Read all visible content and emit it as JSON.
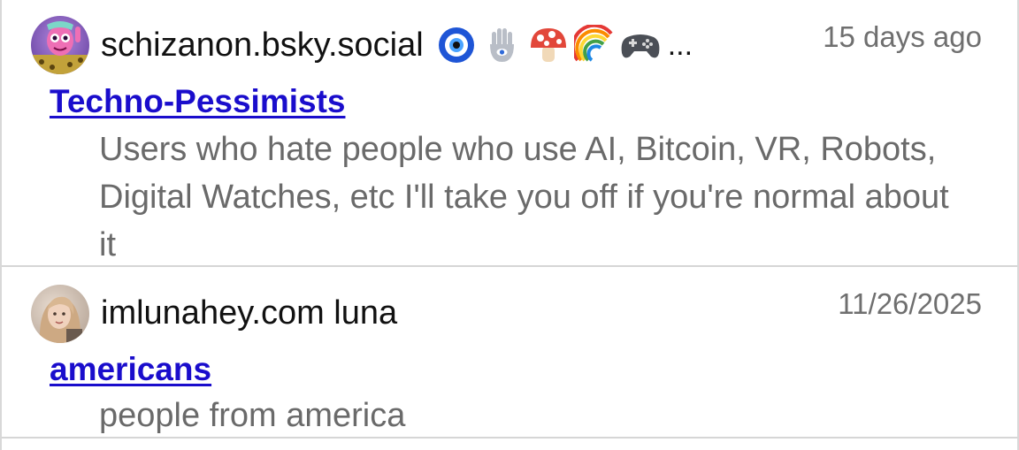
{
  "entries": [
    {
      "author": "schizanon.bsky.social",
      "author_emojis": [
        "nazar-amulet-emoji",
        "hamsa-emoji",
        "mushroom-emoji",
        "rainbow-emoji",
        "game-controller-emoji"
      ],
      "author_overflow": "...",
      "timestamp": "15 days ago",
      "list_name": "Techno-Pessimists",
      "description": "Users who hate people who use AI, Bitcoin, VR, Robots, Digital Watches, etc I'll take you off if you're normal about it",
      "avatar_icon": "avatar-pink-character"
    },
    {
      "author": "imlunahey.com luna",
      "timestamp": "11/26/2025",
      "list_name": "americans",
      "description": "people from america",
      "avatar_icon": "avatar-photo-person"
    }
  ],
  "colors": {
    "link": "#1a0dcc",
    "description": "#6a6a6a",
    "timestamp": "#6f6f6f",
    "divider": "#d6d6d6"
  }
}
